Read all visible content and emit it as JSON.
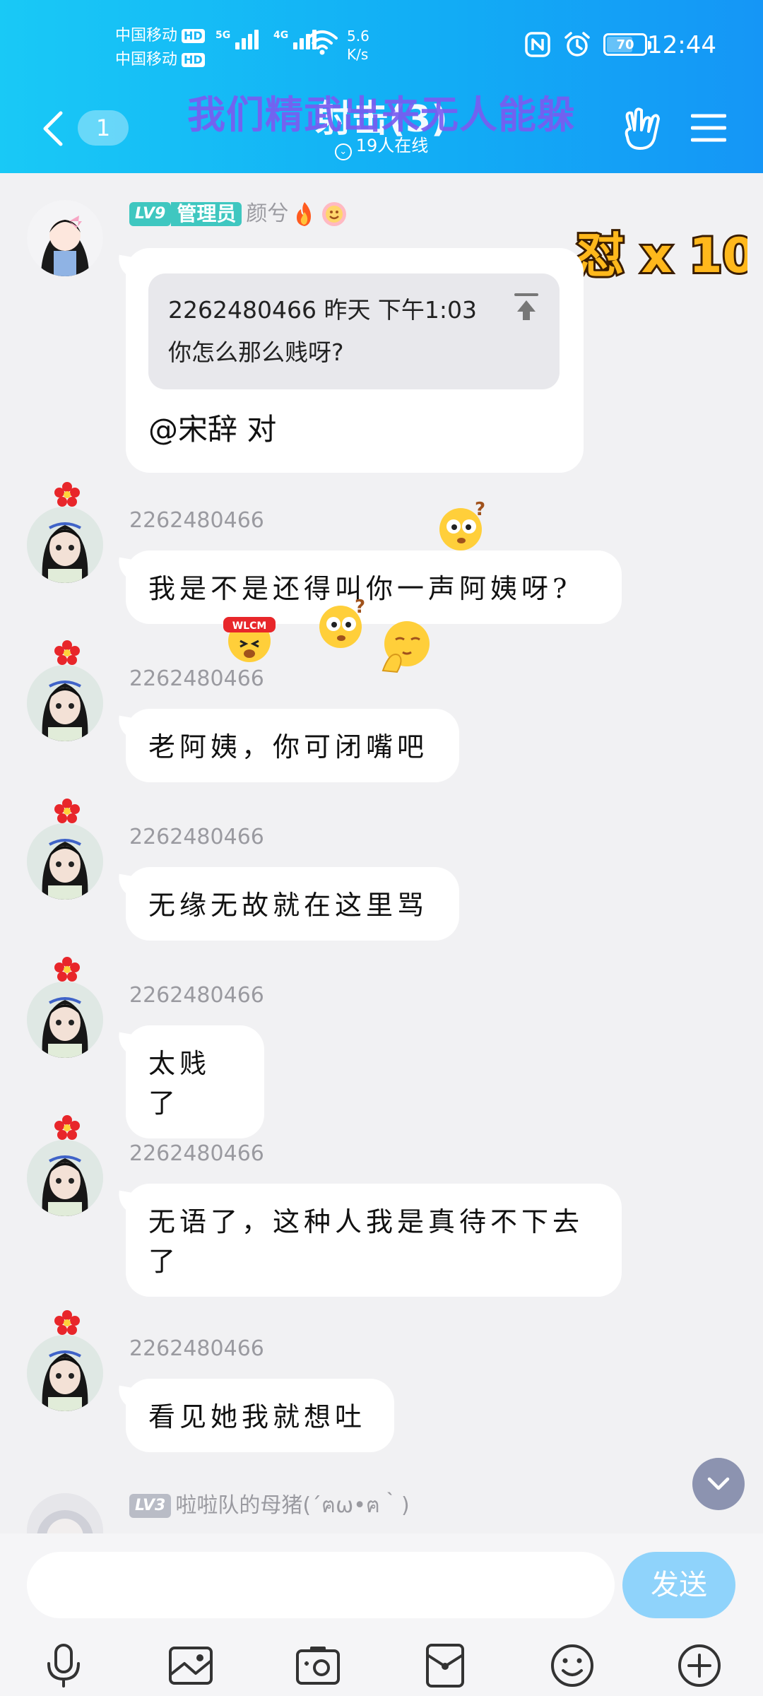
{
  "status_bar": {
    "carrier_1": "中国移动",
    "carrier_2": "中国移动",
    "hd_label": "HD",
    "net_5g": "5G",
    "net_4g": "4G",
    "net_speed_value": "5.6",
    "net_speed_unit": "K/s",
    "battery_level": "70",
    "battery_fraction": 0.7,
    "time": "12:44"
  },
  "title_bar": {
    "unread_count": "1",
    "group_name": "射击(3)",
    "overlay_title": "我们精武出来无人能躲",
    "online_status": "19人在线"
  },
  "combo": {
    "text": "怼 x 10"
  },
  "messages": [
    {
      "level": "LV9",
      "role": "管理员",
      "sender": "颜兮",
      "quote_header": "2262480466 昨天 下午1:03",
      "quote_text": "你怎么那么贱呀?",
      "text": "@宋辞 对"
    },
    {
      "sender": "2262480466",
      "text": "我是不是还得叫你一声阿姨呀?"
    },
    {
      "sender": "2262480466",
      "text": "老阿姨，你可闭嘴吧"
    },
    {
      "sender": "2262480466",
      "text": "无缘无故就在这里骂"
    },
    {
      "sender": "2262480466",
      "text": "太贱了"
    },
    {
      "sender": "2262480466",
      "text": "无语了，这种人我是真待不下去了"
    },
    {
      "sender": "2262480466",
      "text": "看见她我就想吐"
    },
    {
      "level": "LV3",
      "sender": "啦啦队的母猪(´ฅω•ฅ｀)"
    }
  ],
  "input": {
    "placeholder": "",
    "send_label": "发送"
  },
  "colors": {
    "header_gradient_start": "#19c9f6",
    "header_gradient_end": "#1596f6",
    "overlay_title": "#7a5cf0",
    "admin_badge": "#3fc7c0",
    "send_button": "#8fd3fb"
  }
}
